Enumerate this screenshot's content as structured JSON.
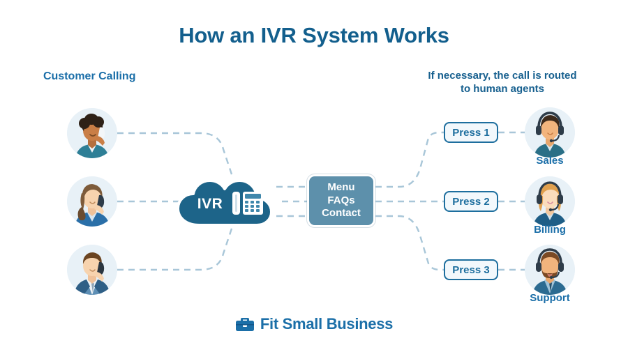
{
  "title": "How an IVR System Works",
  "headings": {
    "left": "Customer Calling",
    "right_line1": "If necessary, the call is routed",
    "right_line2": "to human agents"
  },
  "ivr": {
    "label": "IVR",
    "icon": "desk-phone-icon"
  },
  "menu_box": {
    "line1": "Menu",
    "line2": "FAQs",
    "line3": "Contact"
  },
  "customers": [
    {
      "id": "customer-1",
      "icon": "customer-avatar-woman-curly-hair"
    },
    {
      "id": "customer-2",
      "icon": "customer-avatar-woman-ponytail"
    },
    {
      "id": "customer-3",
      "icon": "customer-avatar-man-suit"
    }
  ],
  "routes": [
    {
      "press_label": "Press 1",
      "agent_label": "Sales",
      "icon": "agent-avatar-man-dark-hair"
    },
    {
      "press_label": "Press 2",
      "agent_label": "Billing",
      "icon": "agent-avatar-woman-blonde"
    },
    {
      "press_label": "Press 3",
      "agent_label": "Support",
      "icon": "agent-avatar-man-beard"
    }
  ],
  "footer": {
    "brand": "Fit Small Business",
    "icon": "briefcase-icon"
  },
  "colors": {
    "title": "#135f8d",
    "heading": "#1a6ea8",
    "cloud": "#1d6489",
    "menu_box": "#5d90ab",
    "press_border": "#1d6e9e",
    "connector": "#a8c6d8",
    "avatar_bg": "#e8f1f7"
  }
}
